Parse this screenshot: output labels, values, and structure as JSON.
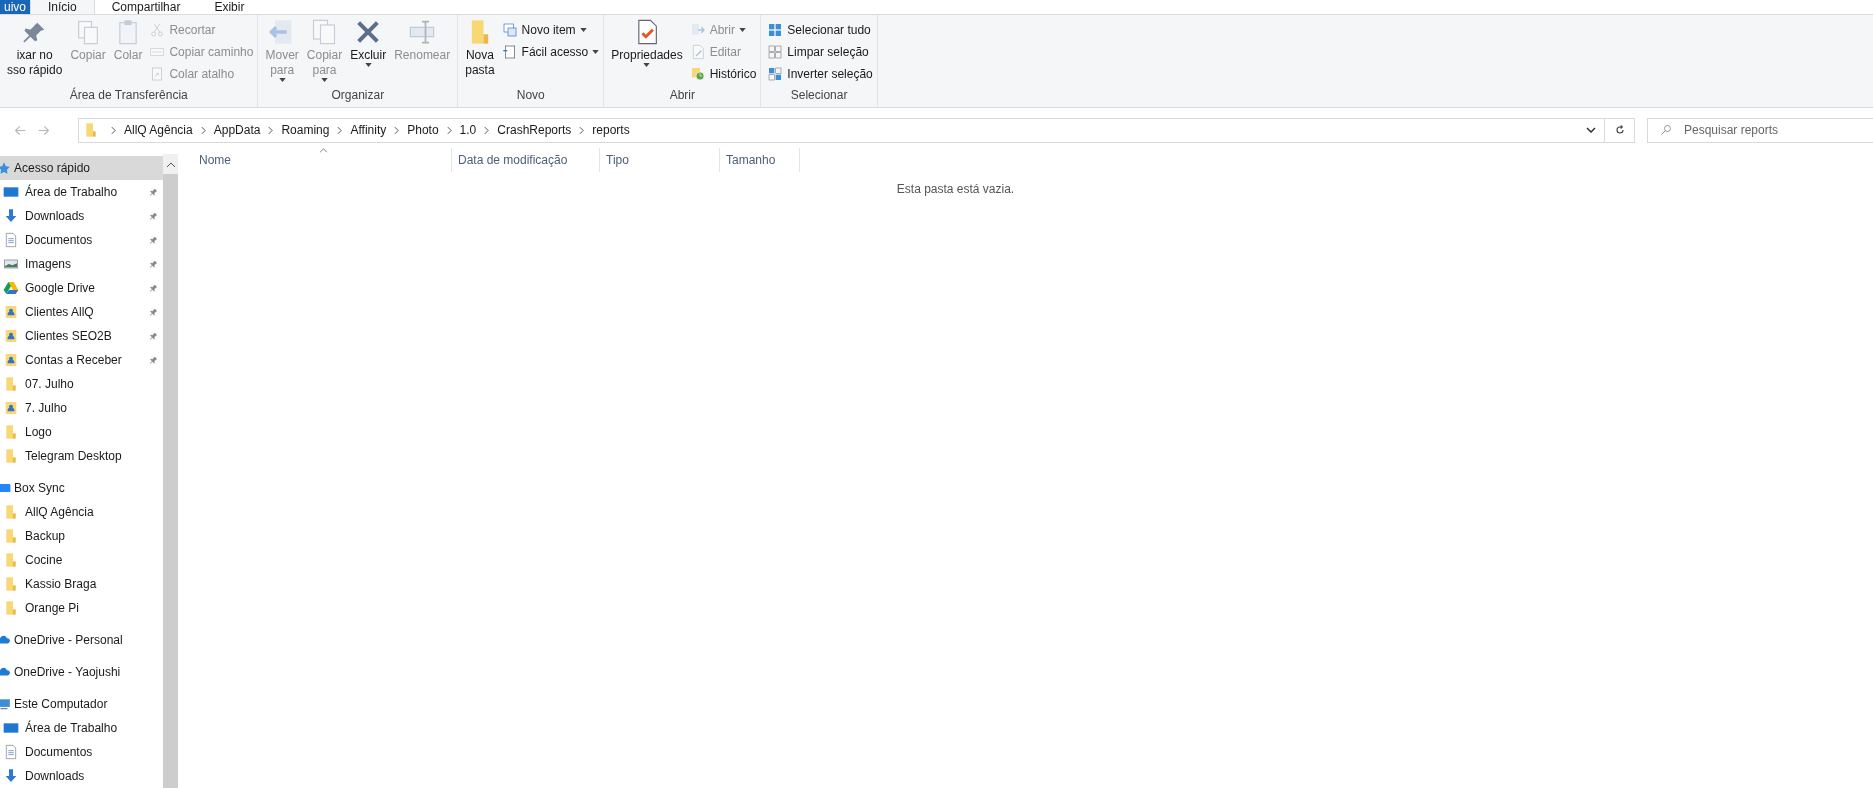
{
  "ribbon_tabs": [
    {
      "label": "uivo",
      "kind": "file",
      "selected": false
    },
    {
      "label": "Início",
      "kind": "tab",
      "selected": true
    },
    {
      "label": "Compartilhar",
      "kind": "tab",
      "selected": false
    },
    {
      "label": "Exibir",
      "kind": "tab",
      "selected": false
    }
  ],
  "ribbon_groups": [
    {
      "title": "Área de Transferência",
      "large": [
        {
          "lines": [
            "ixar no",
            "sso rápido"
          ],
          "disabled": false,
          "dropdown": false
        },
        {
          "lines": [
            "Copiar"
          ],
          "disabled": true,
          "dropdown": false
        },
        {
          "lines": [
            "Colar"
          ],
          "disabled": true,
          "dropdown": false
        }
      ],
      "small": [
        {
          "label": "Recortar",
          "disabled": true,
          "dropdown": false
        },
        {
          "label": "Copiar caminho",
          "disabled": true,
          "dropdown": false
        },
        {
          "label": "Colar atalho",
          "disabled": true,
          "dropdown": false
        }
      ]
    },
    {
      "title": "Organizar",
      "large": [
        {
          "lines": [
            "Mover",
            "para"
          ],
          "disabled": true,
          "dropdown": true
        },
        {
          "lines": [
            "Copiar",
            "para"
          ],
          "disabled": true,
          "dropdown": true
        },
        {
          "lines": [
            "Excluir"
          ],
          "disabled": false,
          "dropdown": true
        },
        {
          "lines": [
            "Renomear"
          ],
          "disabled": true,
          "dropdown": false
        }
      ]
    },
    {
      "title": "Novo",
      "large": [
        {
          "lines": [
            "Nova",
            "pasta"
          ],
          "disabled": false,
          "dropdown": false
        }
      ],
      "small": [
        {
          "label": "Novo item",
          "disabled": false,
          "dropdown": true
        },
        {
          "label": "Fácil acesso",
          "disabled": false,
          "dropdown": true
        }
      ]
    },
    {
      "title": "Abrir",
      "large": [
        {
          "lines": [
            "Propriedades"
          ],
          "disabled": false,
          "dropdown": true
        }
      ],
      "small": [
        {
          "label": "Abrir",
          "disabled": true,
          "dropdown": true
        },
        {
          "label": "Editar",
          "disabled": true,
          "dropdown": false
        },
        {
          "label": "Histórico",
          "disabled": false,
          "dropdown": false
        }
      ]
    },
    {
      "title": "Selecionar",
      "small": [
        {
          "label": "Selecionar tudo",
          "disabled": false,
          "dropdown": false
        },
        {
          "label": "Limpar seleção",
          "disabled": false,
          "dropdown": false
        },
        {
          "label": "Inverter seleção",
          "disabled": false,
          "dropdown": false
        }
      ]
    }
  ],
  "address_bar": {
    "back_disabled": true,
    "forward_disabled": true,
    "path": [
      "AllQ Agência",
      "AppData",
      "Roaming",
      "Affinity",
      "Photo",
      "1.0",
      "CrashReports",
      "reports"
    ]
  },
  "search": {
    "placeholder": "Pesquisar reports"
  },
  "sidebar": {
    "sections": [
      {
        "label": "Acesso rápido",
        "kind": "star",
        "selected": true,
        "items": [
          {
            "label": "Área de Trabalho",
            "kind": "desktop",
            "pinned": true
          },
          {
            "label": "Downloads",
            "kind": "download",
            "pinned": true
          },
          {
            "label": "Documentos",
            "kind": "document",
            "pinned": true
          },
          {
            "label": "Imagens",
            "kind": "image",
            "pinned": true
          },
          {
            "label": "Google Drive",
            "kind": "drive",
            "pinned": true
          },
          {
            "label": "Clientes AllQ",
            "kind": "userfolder",
            "pinned": true
          },
          {
            "label": "Clientes SEO2B",
            "kind": "userfolder",
            "pinned": true
          },
          {
            "label": "Contas a Receber",
            "kind": "userfolder",
            "pinned": true
          },
          {
            "label": "07. Julho",
            "kind": "folder",
            "pinned": false
          },
          {
            "label": "7. Julho",
            "kind": "userfolder",
            "pinned": false
          },
          {
            "label": "Logo",
            "kind": "folder",
            "pinned": false
          },
          {
            "label": "Telegram Desktop",
            "kind": "folder",
            "pinned": false
          }
        ]
      },
      {
        "label": "Box Sync",
        "kind": "box",
        "selected": false,
        "items": [
          {
            "label": "AllQ Agência",
            "kind": "folder",
            "pinned": false
          },
          {
            "label": "Backup",
            "kind": "folder",
            "pinned": false
          },
          {
            "label": "Cocine",
            "kind": "folder",
            "pinned": false
          },
          {
            "label": "Kassio Braga",
            "kind": "folder",
            "pinned": false
          },
          {
            "label": "Orange Pi",
            "kind": "folder",
            "pinned": false
          }
        ]
      },
      {
        "label": "OneDrive - Personal",
        "kind": "cloud",
        "selected": false
      },
      {
        "label": "OneDrive - Yaojushi",
        "kind": "cloud",
        "selected": false
      },
      {
        "label": "Este Computador",
        "kind": "computer",
        "selected": false,
        "items": [
          {
            "label": "Área de Trabalho",
            "kind": "desktop",
            "pinned": false
          },
          {
            "label": "Documentos",
            "kind": "document",
            "pinned": false
          },
          {
            "label": "Downloads",
            "kind": "download",
            "pinned": false
          }
        ]
      }
    ]
  },
  "file_list": {
    "columns": [
      {
        "label": "Nome",
        "sorted": true
      },
      {
        "label": "Data de modificação",
        "sorted": false
      },
      {
        "label": "Tipo",
        "sorted": false
      },
      {
        "label": "Tamanho",
        "sorted": false
      }
    ],
    "empty_message": "Esta pasta está vazia."
  }
}
